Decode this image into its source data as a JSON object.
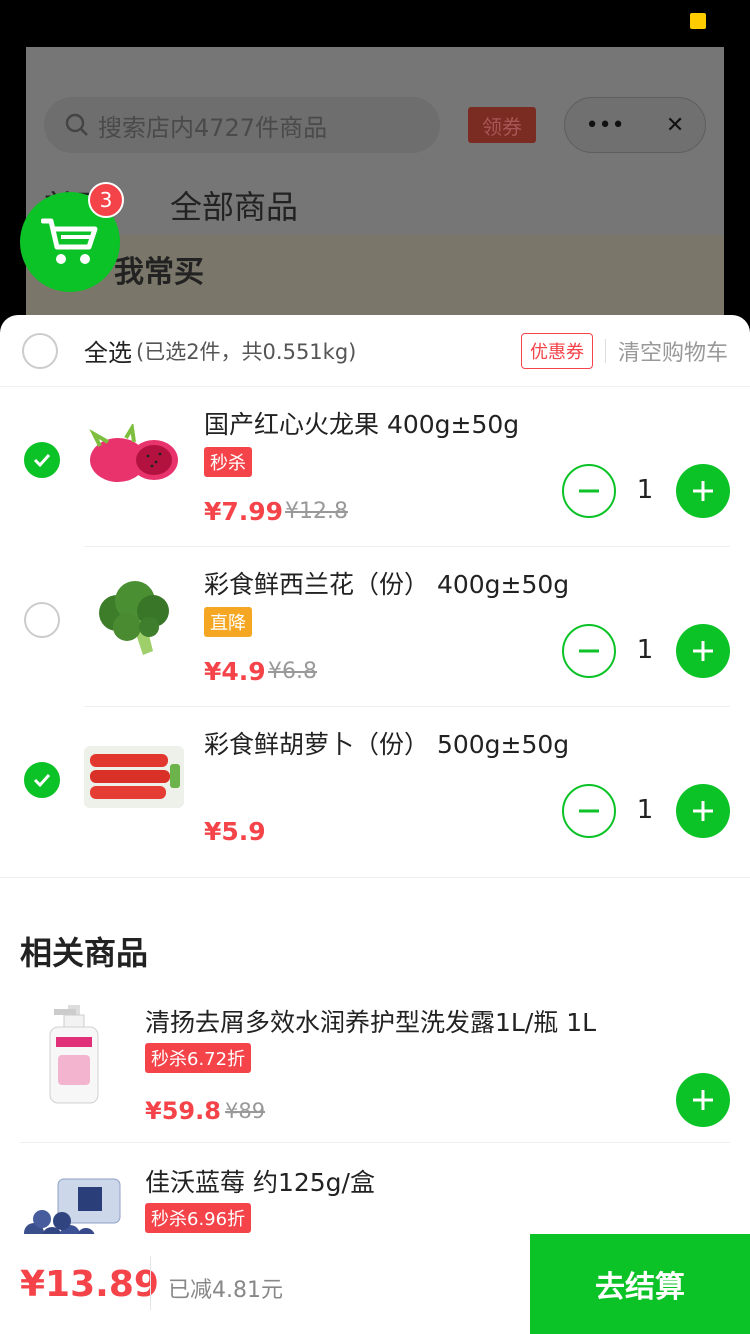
{
  "background_page": {
    "search_placeholder": "搜索店内4727件商品",
    "coupon_label": "领券",
    "capsule_more": "•••",
    "capsule_close": "✕",
    "tab_home": "首页",
    "tab_all": "全部商品",
    "frequent_label": "我常买"
  },
  "cart_fab": {
    "badge_count": "3"
  },
  "sheet": {
    "select_all_label": "全选",
    "select_all_info": "(已选2件，共0.551kg)",
    "coupon_tag": "优惠券",
    "clear_cart": "清空购物车"
  },
  "cart_items": [
    {
      "name": "国产红心火龙果 400g±50g",
      "tag": "秒杀",
      "tag_color": "#f4444a",
      "price": "¥7.99",
      "orig_price": "¥12.8",
      "qty": "1",
      "checked": true,
      "icon": "dragonfruit-image"
    },
    {
      "name": "彩食鲜西兰花（份） 400g±50g",
      "tag": "直降",
      "tag_color": "#f5a623",
      "price": "¥4.9",
      "orig_price": "¥6.8",
      "qty": "1",
      "checked": false,
      "icon": "broccoli-image"
    },
    {
      "name": "彩食鲜胡萝卜（份） 500g±50g",
      "tag": "",
      "price": "¥5.9",
      "orig_price": "",
      "qty": "1",
      "checked": true,
      "icon": "carrot-image"
    }
  ],
  "related": {
    "title": "相关商品",
    "items": [
      {
        "name": "清扬去屑多效水润养护型洗发露1L/瓶 1L",
        "tag": "秒杀6.72折",
        "price": "¥59.8",
        "orig_price": "¥89",
        "icon": "shampoo-image"
      },
      {
        "name": "佳沃蓝莓 约125g/盒",
        "tag": "秒杀6.96折",
        "price": "",
        "orig_price": "",
        "icon": "blueberry-image"
      }
    ]
  },
  "bottom_bar": {
    "total": "¥13.89",
    "discount": "已减4.81元",
    "checkout_label": "去结算"
  },
  "colors": {
    "accent": "#0bc227",
    "price_red": "#f4444a",
    "tag_orange": "#f5a623"
  }
}
